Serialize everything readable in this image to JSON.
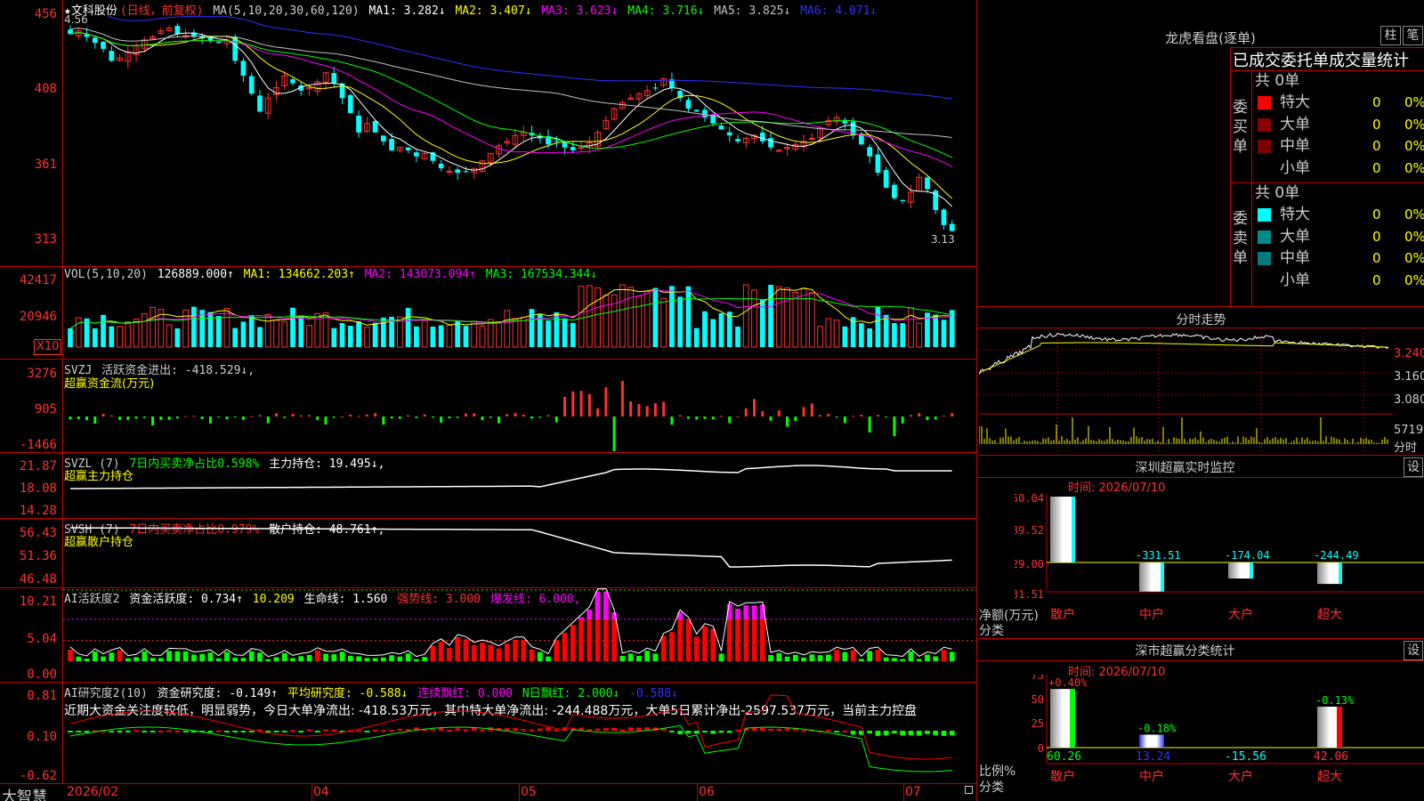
{
  "chart_data": [
    {
      "type": "candlestick",
      "title": "★文科股份",
      "subtitle": "(日线，前复权)",
      "indicator_label": "MA(5,10,20,30,60,120)",
      "ma_labels": [
        "MA1: 3.282↓",
        "MA2: 3.407↓",
        "MA3: 3.623↓",
        "MA4: 3.716↓",
        "MA5: 3.825↓",
        "MA6: 4.071↓"
      ],
      "high_label": "4.56",
      "low_label": "3.13",
      "yticks": [
        "456",
        "408",
        "361",
        "313"
      ],
      "ylim": [
        3.05,
        4.6
      ],
      "x_labels": [
        "2026/02",
        "04",
        "05",
        "06",
        "07"
      ],
      "closes": [
        4.48,
        4.5,
        4.46,
        4.42,
        4.38,
        4.3,
        4.32,
        4.36,
        4.4,
        4.44,
        4.46,
        4.5,
        4.52,
        4.48,
        4.47,
        4.46,
        4.45,
        4.43,
        4.42,
        4.44,
        4.3,
        4.2,
        4.08,
        3.96,
        4.05,
        4.12,
        4.2,
        4.15,
        4.1,
        4.12,
        4.16,
        4.22,
        4.15,
        4.05,
        3.95,
        3.82,
        3.88,
        3.82,
        3.76,
        3.7,
        3.72,
        3.7,
        3.66,
        3.68,
        3.63,
        3.58,
        3.56,
        3.55,
        3.56,
        3.58,
        3.63,
        3.68,
        3.73,
        3.76,
        3.8,
        3.82,
        3.8,
        3.78,
        3.74,
        3.76,
        3.72,
        3.7,
        3.72,
        3.75,
        3.82,
        3.9,
        3.98,
        4.02,
        4.05,
        4.08,
        4.1,
        4.12,
        4.18,
        4.12,
        4.05,
        3.98,
        3.96,
        3.92,
        3.88,
        3.84,
        3.8,
        3.76,
        3.78,
        3.8,
        3.76,
        3.72,
        3.7,
        3.72,
        3.74,
        3.76,
        3.78,
        3.85,
        3.9,
        3.92,
        3.88,
        3.8,
        3.74,
        3.66,
        3.55,
        3.45,
        3.38,
        3.36,
        3.42,
        3.52,
        3.44,
        3.3,
        3.2,
        3.16
      ],
      "ma_series": [
        {
          "name": "MA1",
          "color": "#ffffff"
        },
        {
          "name": "MA2",
          "color": "#ffff00"
        },
        {
          "name": "MA3",
          "color": "#ff00ff"
        },
        {
          "name": "MA4",
          "color": "#00ff00"
        },
        {
          "name": "MA5",
          "color": "#c0c0c0"
        },
        {
          "name": "MA6",
          "color": "#3030ff"
        }
      ]
    },
    {
      "type": "bar",
      "indicator_label": "VOL(5,10,20)",
      "values_header": [
        "126889.000↑",
        "MA1: 134662.203↑",
        "MA2: 143073.094↑",
        "MA3: 167534.344↓"
      ],
      "yticks": [
        "42417",
        "20946"
      ],
      "unit_badge": "X10",
      "volume_scale_max": 42417
    },
    {
      "type": "bar",
      "indicator_label": "SVZJ",
      "values_header": "活跃资金进出: -418.529↓,",
      "sublabel": "超赢资金流(万元)",
      "yticks": [
        "3276",
        "905",
        "-1466"
      ]
    },
    {
      "type": "line",
      "indicator_label": "SVZL (7)",
      "desc": "7日内买卖净占比0.598%",
      "values_header": "主力持仓: 19.495↓,",
      "sublabel": "超赢主力持仓",
      "yticks": [
        "21.87",
        "18.08",
        "14.28"
      ]
    },
    {
      "type": "line",
      "indicator_label": "SVSH (7)",
      "desc": "7日内买卖净占比0.979%",
      "values_header": "散户持仓: 48.761↑,",
      "sublabel": "超赢散户持仓",
      "yticks": [
        "56.43",
        "51.36",
        "46.48"
      ]
    },
    {
      "type": "bar",
      "indicator_label": "AI活跃度2",
      "values_header": [
        "资金活跃度: 0.734↑",
        "10.209",
        "生命线: 1.560",
        "强势线: 3.000",
        "爆发线: 6.000,"
      ],
      "yticks": [
        "10.21",
        "5.04",
        "0.00"
      ]
    },
    {
      "type": "bar",
      "indicator_label": "AI研究度2(10)",
      "values_header": [
        "资金研究度: -0.149↑",
        "平均研究度: -0.588↓",
        "连续飘红: 0.000",
        "N日飘红: 2.000↓",
        "-0.588↓"
      ],
      "comment": "近期大资金关注度较低，明显弱势，今日大单净流出: -418.53万元，其中特大单净流出: -244.488万元，大单5日累计净出-2597.537万元，当前主力控盘",
      "yticks": [
        "0.81",
        "0.10",
        "-0.62"
      ]
    },
    {
      "type": "bar",
      "title": "深圳超赢实时监控",
      "time_label": "时间: 2026/07/10",
      "yticks": [
        "750.04",
        "389.52",
        "29.00",
        "-331.51"
      ],
      "categories": [
        "散户",
        "中户",
        "大户",
        "超大"
      ],
      "values": [
        750.04,
        -331.51,
        -174.04,
        -244.49
      ],
      "ylabel": "净额(万元)",
      "xlabel": "分类"
    },
    {
      "type": "bar",
      "title": "深市超赢分类统计",
      "time_label": "时间: 2026/07/10",
      "yticks": [
        "75",
        "50",
        "25",
        "0"
      ],
      "categories": [
        "散户",
        "中户",
        "大户",
        "超大"
      ],
      "top_labels": [
        "+0.40%",
        "-0.18%",
        "-0.13%"
      ],
      "values": [
        60.26,
        13.24,
        -15.56,
        42.06
      ],
      "ylabel": "比例%",
      "xlabel": "分类"
    },
    {
      "type": "line",
      "title": "分时走势",
      "yticks": [
        "3.240",
        "3.160",
        "3.080"
      ],
      "vol_label": "5719",
      "xlabel": "分时"
    }
  ],
  "brand": "大智慧",
  "dragon_tiger": {
    "title": "龙虎看盘(逐单)",
    "btn_bar": "柱",
    "btn_stroke": "笔",
    "stats_title": "已成交委托单成交量统计",
    "buy_label": "委买单",
    "sell_label": "委卖单",
    "buy_total": "共 0单",
    "sell_total": "共 0单",
    "buy_rows": [
      {
        "label": "特大",
        "count": "0",
        "pct": "0%",
        "color": "#ff0000"
      },
      {
        "label": "大单",
        "count": "0",
        "pct": "0%",
        "color": "#8b0000"
      },
      {
        "label": "中单",
        "count": "0",
        "pct": "0%",
        "color": "#7a0000"
      },
      {
        "label": "小单",
        "count": "0",
        "pct": "0%",
        "color": ""
      }
    ],
    "sell_rows": [
      {
        "label": "特大",
        "count": "0",
        "pct": "0%",
        "color": "#00ffff"
      },
      {
        "label": "大单",
        "count": "0",
        "pct": "0%",
        "color": "#008b8b"
      },
      {
        "label": "中单",
        "count": "0",
        "pct": "0%",
        "color": "#007a7a"
      },
      {
        "label": "小单",
        "count": "0",
        "pct": "0%",
        "color": ""
      }
    ]
  },
  "settings_label": "设"
}
